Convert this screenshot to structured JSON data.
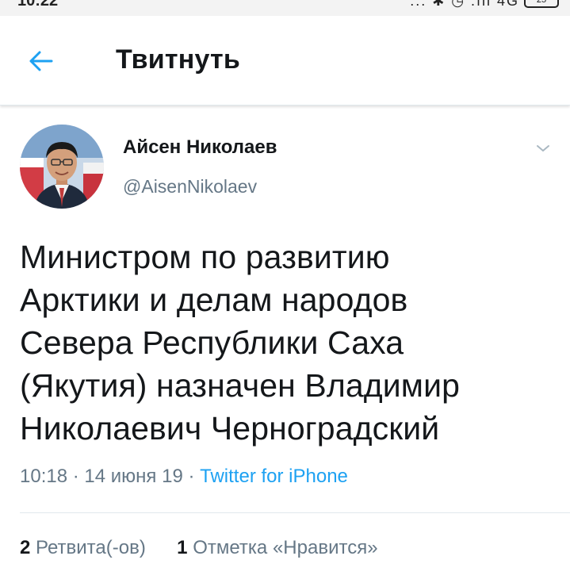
{
  "status_bar": {
    "time": "10:22",
    "icons": "... ✱ ◷ .ıll 4G",
    "battery": "25"
  },
  "header": {
    "back_icon": "arrow-left-icon",
    "title": "Твитнуть"
  },
  "tweet": {
    "display_name": "Айсен Николаев",
    "handle": "@AisenNikolaev",
    "menu_icon": "chevron-down-icon",
    "text": "Министром по развитию\nАрктики и делам народов\nСевера Республики Саха\n(Якутия) назначен Владимир\nНиколаевич Черноградский",
    "time": "10:18",
    "date": "14 июня 19",
    "separator": "·",
    "source": "Twitter for iPhone",
    "retweets": {
      "count": "2",
      "label": "Ретвита(-ов)"
    },
    "likes": {
      "count": "1",
      "label": "Отметка «Нравится»"
    }
  },
  "colors": {
    "accent": "#1da1f2",
    "secondary_text": "#657786",
    "primary_text": "#14171a",
    "divider": "#e1e8ed"
  }
}
